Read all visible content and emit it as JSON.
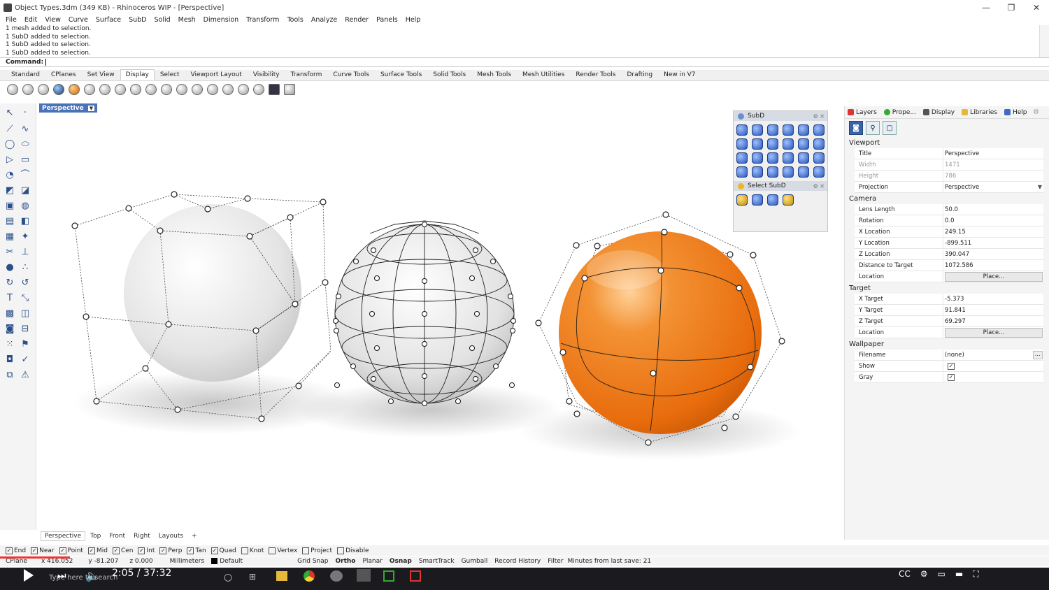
{
  "window": {
    "title": "Object Types.3dm (349 KB) - Rhinoceros WIP - [Perspective]",
    "controls": [
      "—",
      "❐",
      "✕"
    ]
  },
  "menu": [
    "File",
    "Edit",
    "View",
    "Curve",
    "Surface",
    "SubD",
    "Solid",
    "Mesh",
    "Dimension",
    "Transform",
    "Tools",
    "Analyze",
    "Render",
    "Panels",
    "Help"
  ],
  "command_history": [
    "1 mesh added to selection.",
    "1 SubD added to selection.",
    "1 SubD added to selection.",
    "1 SubD added to selection."
  ],
  "command_prompt": "Command:",
  "toolbar_tabs": [
    "Standard",
    "CPlanes",
    "Set View",
    "Display",
    "Select",
    "Viewport Layout",
    "Visibility",
    "Transform",
    "Curve Tools",
    "Surface Tools",
    "Solid Tools",
    "Mesh Tools",
    "Mesh Utilities",
    "Render Tools",
    "Drafting",
    "New in V7"
  ],
  "active_toolbar_tab": "Display",
  "viewport": {
    "label": "Perspective",
    "bottom_tabs": [
      "Perspective",
      "Top",
      "Front",
      "Right",
      "Layouts",
      "+"
    ]
  },
  "subd_panel": {
    "title": "SubD",
    "select_title": "Select SubD"
  },
  "right_panel": {
    "tabs": [
      "Layers",
      "Prope...",
      "Display",
      "Libraries",
      "Help"
    ],
    "sections": {
      "viewport": "Viewport",
      "camera": "Camera",
      "target": "Target",
      "wallpaper": "Wallpaper"
    },
    "viewport_rows": {
      "title_k": "Title",
      "title_v": "Perspective",
      "width_k": "Width",
      "width_v": "1471",
      "height_k": "Height",
      "height_v": "786",
      "projection_k": "Projection",
      "projection_v": "Perspective"
    },
    "camera_rows": {
      "lens_k": "Lens Length",
      "lens_v": "50.0",
      "rot_k": "Rotation",
      "rot_v": "0.0",
      "x_k": "X Location",
      "x_v": "249.15",
      "y_k": "Y Location",
      "y_v": "-899.511",
      "z_k": "Z Location",
      "z_v": "390.047",
      "dist_k": "Distance to Target",
      "dist_v": "1072.586",
      "loc_k": "Location",
      "loc_btn": "Place..."
    },
    "target_rows": {
      "x_k": "X Target",
      "x_v": "-5.373",
      "y_k": "Y Target",
      "y_v": "91.841",
      "z_k": "Z Target",
      "z_v": "69.297",
      "loc_k": "Location",
      "loc_btn": "Place..."
    },
    "wallpaper_rows": {
      "file_k": "Filename",
      "file_v": "(none)",
      "show_k": "Show",
      "gray_k": "Gray"
    }
  },
  "osnaps": [
    {
      "label": "End",
      "checked": true
    },
    {
      "label": "Near",
      "checked": true
    },
    {
      "label": "Point",
      "checked": true
    },
    {
      "label": "Mid",
      "checked": true
    },
    {
      "label": "Cen",
      "checked": true
    },
    {
      "label": "Int",
      "checked": true
    },
    {
      "label": "Perp",
      "checked": true
    },
    {
      "label": "Tan",
      "checked": true
    },
    {
      "label": "Quad",
      "checked": true
    },
    {
      "label": "Knot",
      "checked": false
    },
    {
      "label": "Vertex",
      "checked": false
    },
    {
      "label": "Project",
      "checked": false
    },
    {
      "label": "Disable",
      "checked": false
    }
  ],
  "status": {
    "cplane": "CPlane",
    "x": "x 416.052",
    "y": "y -81.207",
    "z": "z 0.000",
    "units": "Millimeters",
    "layer": "Default",
    "grid_snap": "Grid Snap",
    "ortho": "Ortho",
    "planar": "Planar",
    "osnap": "Osnap",
    "smarttrack": "SmartTrack",
    "gumball": "Gumball",
    "record_history": "Record History",
    "filter": "Filter",
    "save_msg": "Minutes from last save: 21"
  },
  "video": {
    "time": "2:05 / 37:32",
    "search_placeholder": "Type here to search",
    "progress": 0.056
  },
  "colors": {
    "accent": "#4a72b8",
    "orange_sphere": "#f07b12"
  }
}
